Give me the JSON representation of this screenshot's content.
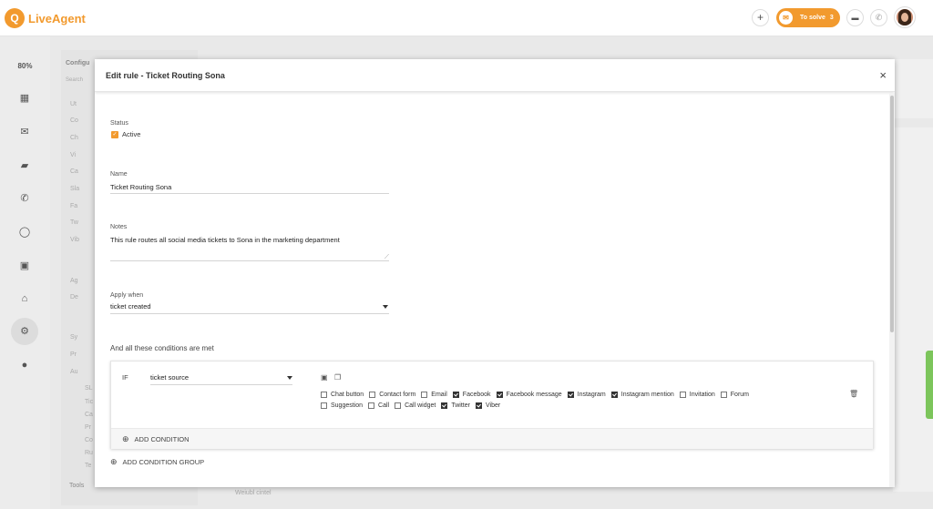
{
  "topbar": {
    "logo_mark": "Q",
    "app_name": "LiveAgent",
    "add_icon": "+",
    "to_solve_label": "To solve",
    "to_solve_count": "3"
  },
  "sidebar": {
    "zoom": "80%"
  },
  "background": {
    "section_title": "Configu",
    "search_placeholder": "Search",
    "items": [
      "Ut",
      "Co",
      "Ch",
      "Vi",
      "Ca",
      "Sla",
      "Fa",
      "Tw",
      "Vib",
      "Ag",
      "De",
      "Sy",
      "Pr",
      "Au",
      "SL",
      "Tic",
      "Ca",
      "Pr",
      "Co",
      "Ru",
      "Te"
    ],
    "tools": "Tools",
    "bottom_text": "Weiubl cintel"
  },
  "modal": {
    "title": "Edit rule - Ticket Routing Sona",
    "close": "×",
    "status_label": "Status",
    "status_value": "Active",
    "name_label": "Name",
    "name_value": "Ticket Routing Sona",
    "notes_label": "Notes",
    "notes_value": "This rule routes all social media tickets to Sona in the marketing department",
    "apply_label": "Apply when",
    "apply_value": "ticket created",
    "conditions_heading": "And all these conditions are met",
    "condition": {
      "if_label": "IF",
      "field_value": "ticket source",
      "sources_row1": [
        {
          "label": "Chat button",
          "checked": false
        },
        {
          "label": "Contact form",
          "checked": false
        },
        {
          "label": "Email",
          "checked": false
        },
        {
          "label": "Facebook",
          "checked": true
        },
        {
          "label": "Facebook message",
          "checked": true
        },
        {
          "label": "Instagram",
          "checked": true
        },
        {
          "label": "Instagram mention",
          "checked": true
        },
        {
          "label": "Invitation",
          "checked": false
        },
        {
          "label": "Forum",
          "checked": false
        }
      ],
      "sources_row2": [
        {
          "label": "Suggestion",
          "checked": false
        },
        {
          "label": "Call",
          "checked": false
        },
        {
          "label": "Call widget",
          "checked": false
        },
        {
          "label": "Twitter",
          "checked": true
        },
        {
          "label": "Viber",
          "checked": true
        }
      ]
    },
    "add_condition": "ADD CONDITION",
    "add_condition_group": "ADD CONDITION GROUP"
  },
  "colors": {
    "accent": "#f29a2e",
    "success": "#7cc55b"
  }
}
